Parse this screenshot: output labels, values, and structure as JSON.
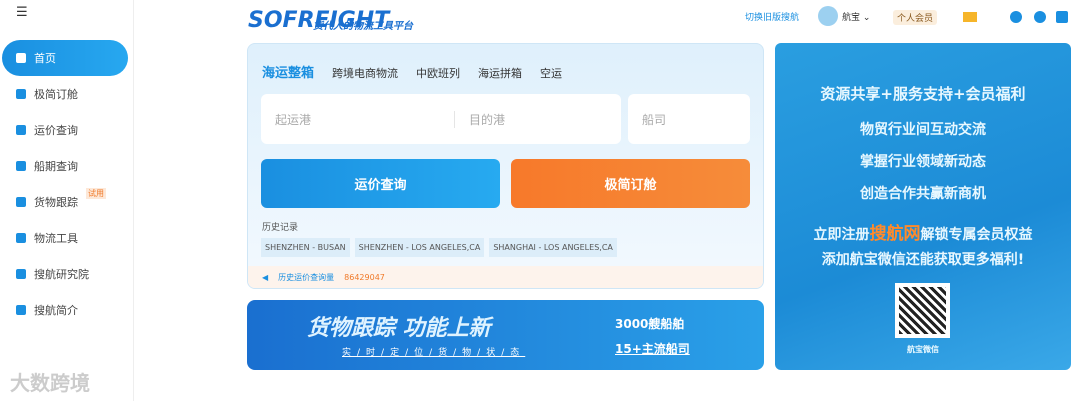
{
  "sidebar": {
    "items": [
      {
        "label": "首页"
      },
      {
        "label": "极简订舱"
      },
      {
        "label": "运价查询"
      },
      {
        "label": "船期查询"
      },
      {
        "label": "货物跟踪",
        "badge": "试用"
      },
      {
        "label": "物流工具"
      },
      {
        "label": "搜航研究院"
      },
      {
        "label": "搜航简介"
      }
    ],
    "watermark": "大数跨境"
  },
  "header": {
    "logo": "SOFREIGHT",
    "slogan": "货代人的物流工具平台",
    "old_version": "切换旧版搜航",
    "user": "航宝",
    "member": "个人会员"
  },
  "search": {
    "tabs": [
      "海运整箱",
      "跨境电商物流",
      "中欧班列",
      "海运拼箱",
      "空运"
    ],
    "origin_placeholder": "起运港",
    "dest_placeholder": "目的港",
    "carrier_placeholder": "船司",
    "query_btn": "运价查询",
    "book_btn": "极简订舱",
    "history_title": "历史记录",
    "history": [
      "SHENZHEN - BUSAN",
      "SHENZHEN - LOS ANGELES,CA",
      "SHANGHAI - LOS ANGELES,CA"
    ],
    "notice_label": "历史运价查询量",
    "notice_value": "86429047"
  },
  "banner": {
    "title": "货物跟踪  功能上新",
    "sub": "实/时/定/位/货/物/状/态",
    "stat1": "3000艘船舶",
    "stat2": "15+主流船司"
  },
  "promo": {
    "l1": "资源共享+服务支持+会员福利",
    "l2": "物贸行业间互动交流",
    "l3": "掌握行业领域新动态",
    "l4": "创造合作共赢新商机",
    "l5a": "立即注册",
    "l5b": "搜航网",
    "l5c": "解锁专属会员权益",
    "l6": "添加航宝微信还能获取更多福利!",
    "qr_label": "航宝微信"
  }
}
